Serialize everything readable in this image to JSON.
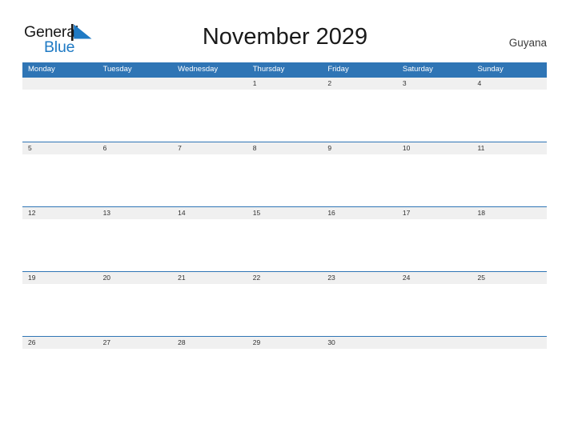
{
  "brand": {
    "name_part1": "General",
    "name_part2": "Blue",
    "flag_icon": "blue-triangle-flag-icon",
    "accent_color": "#1f7ac4"
  },
  "header": {
    "title": "November 2029",
    "region": "Guyana"
  },
  "calendar": {
    "month": "November",
    "year": "2029",
    "header_bg_color": "#2f75b5",
    "row_band_color": "#f0f0f0",
    "weekdays": [
      "Monday",
      "Tuesday",
      "Wednesday",
      "Thursday",
      "Friday",
      "Saturday",
      "Sunday"
    ],
    "weeks": [
      [
        "",
        "",
        "",
        "1",
        "2",
        "3",
        "4"
      ],
      [
        "5",
        "6",
        "7",
        "8",
        "9",
        "10",
        "11"
      ],
      [
        "12",
        "13",
        "14",
        "15",
        "16",
        "17",
        "18"
      ],
      [
        "19",
        "20",
        "21",
        "22",
        "23",
        "24",
        "25"
      ],
      [
        "26",
        "27",
        "28",
        "29",
        "30",
        "",
        ""
      ]
    ]
  }
}
